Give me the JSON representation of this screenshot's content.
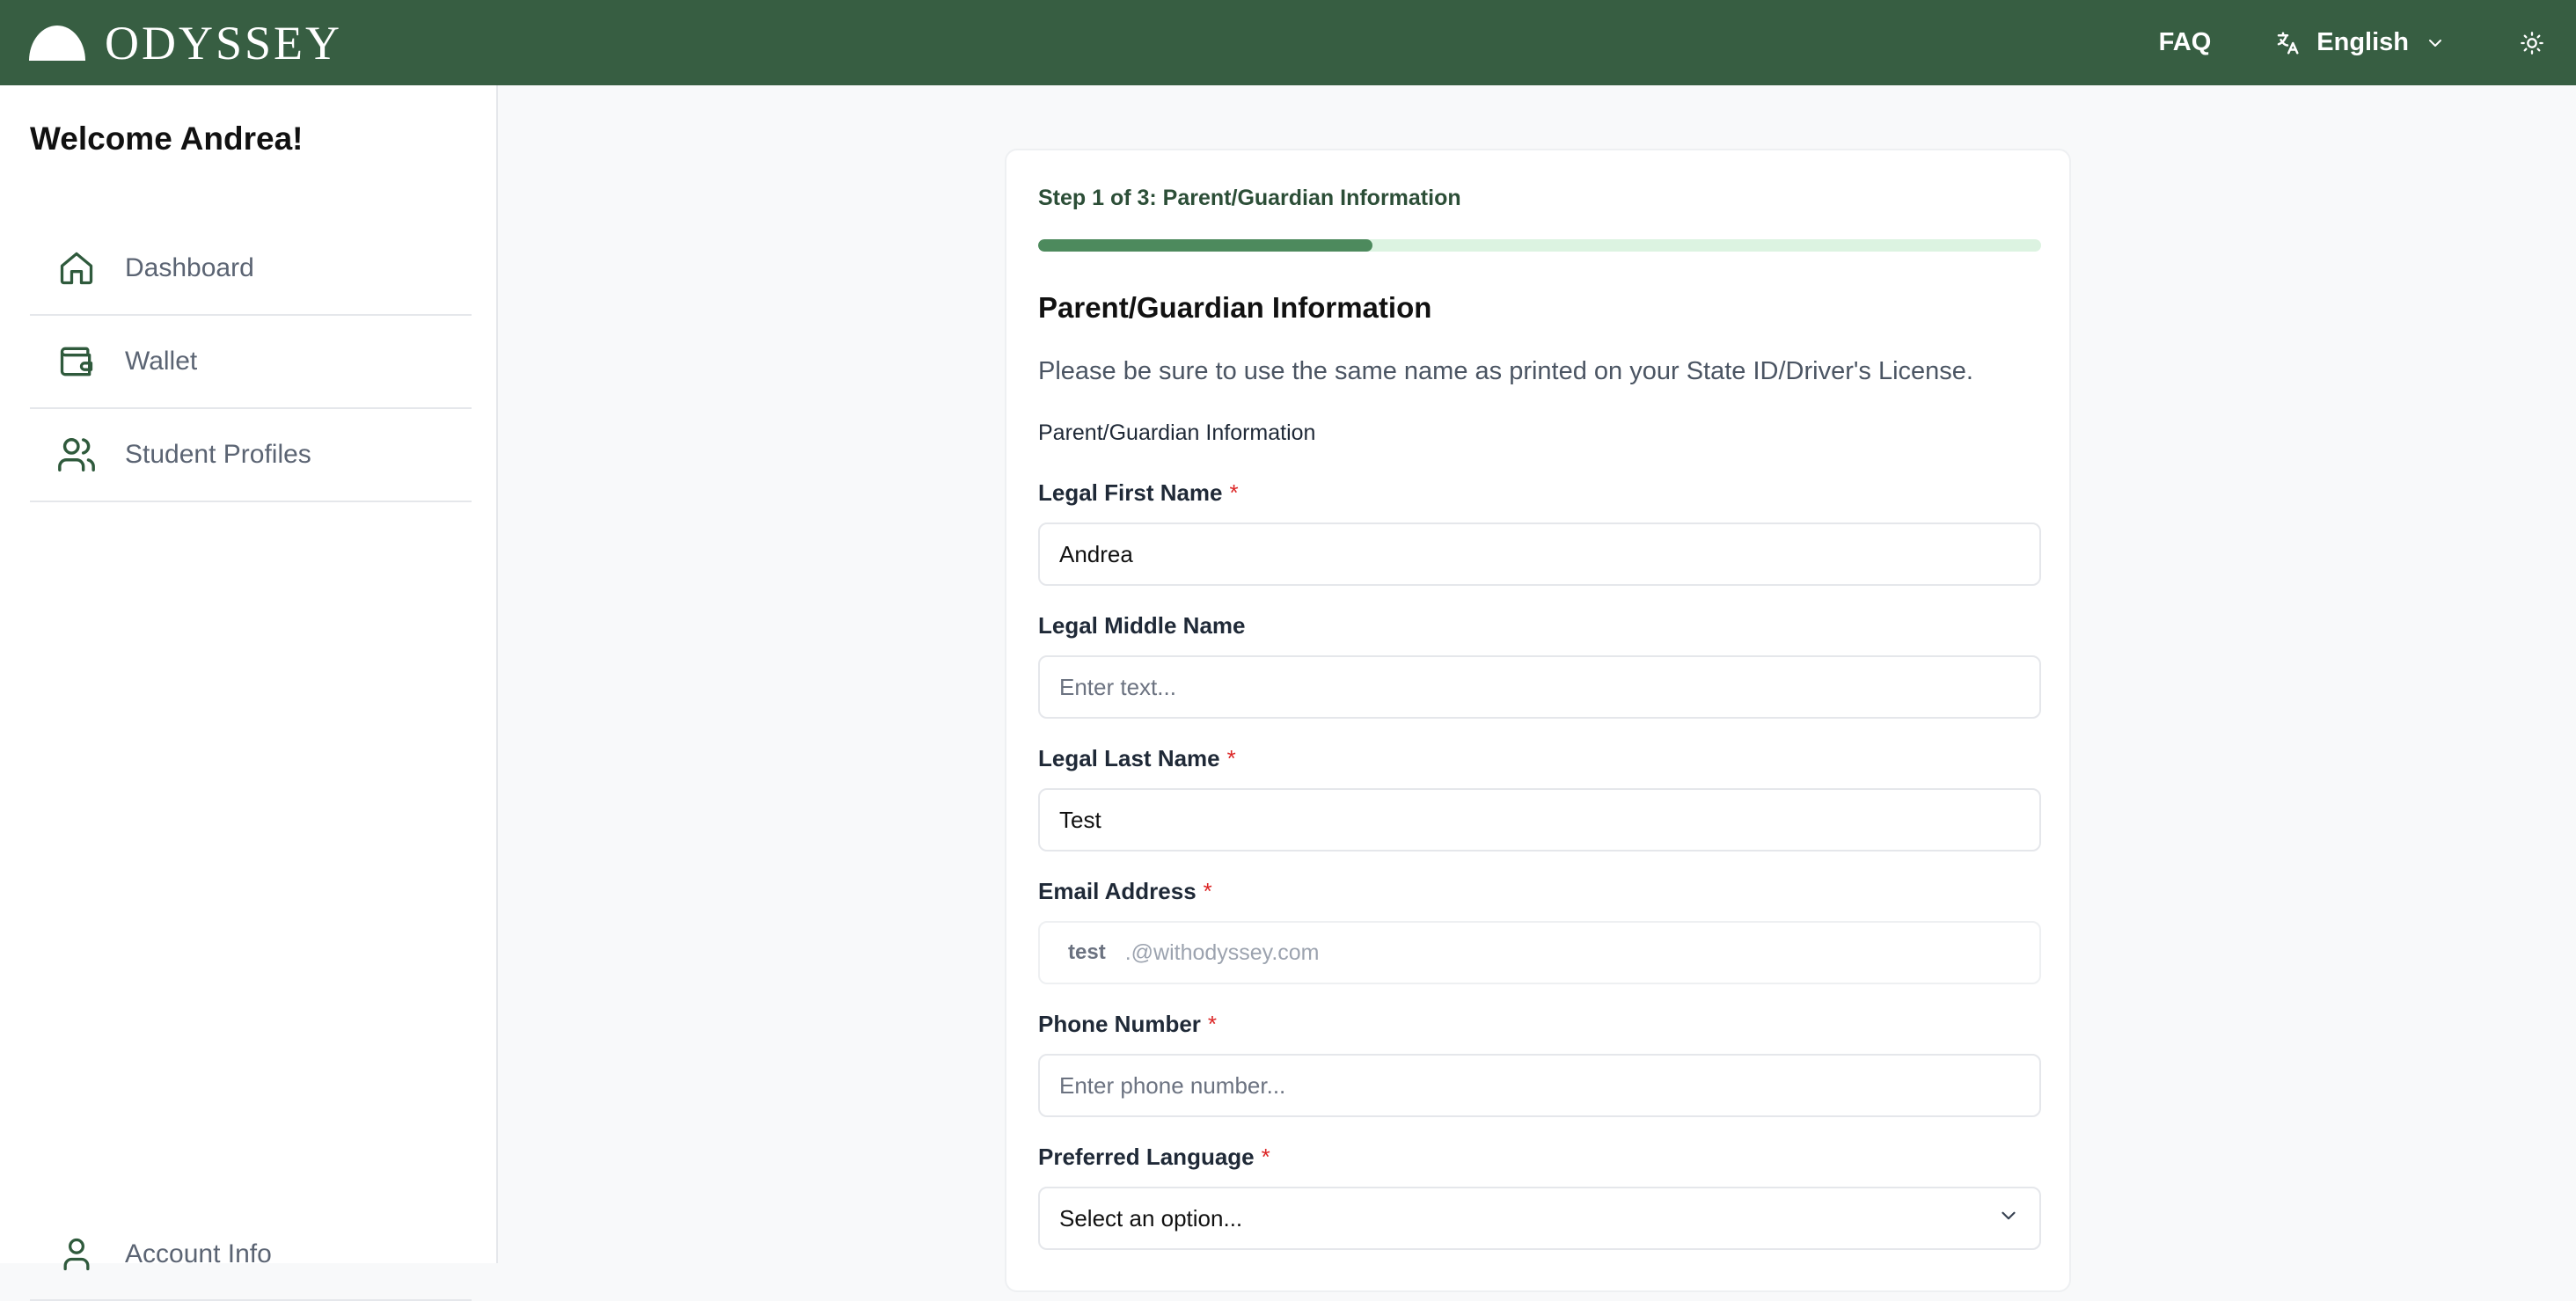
{
  "header": {
    "brand": "ODYSSEY",
    "faq": "FAQ",
    "language": "English"
  },
  "sidebar": {
    "welcome": "Welcome Andrea!",
    "items": [
      {
        "label": "Dashboard",
        "icon": "home-icon"
      },
      {
        "label": "Wallet",
        "icon": "wallet-icon"
      },
      {
        "label": "Student Profiles",
        "icon": "users-icon"
      }
    ],
    "bottom_item": {
      "label": "Account Info",
      "icon": "user-icon"
    }
  },
  "form": {
    "step": "Step 1 of 3: Parent/Guardian Information",
    "progress_fraction": 0.333,
    "title": "Parent/Guardian Information",
    "subtitle": "Please be sure to use the same name as printed on your State ID/Driver's License.",
    "section_label": "Parent/Guardian Information",
    "required_marker": "*",
    "first_name": {
      "label": "Legal First Name",
      "value": "Andrea",
      "placeholder": "Enter text..."
    },
    "middle_name": {
      "label": "Legal Middle Name",
      "value": "",
      "placeholder": "Enter text..."
    },
    "last_name": {
      "label": "Legal Last Name",
      "value": "Test",
      "placeholder": "Enter text..."
    },
    "email": {
      "label": "Email Address",
      "prefix": "test",
      "domain": ".@withodyssey.com"
    },
    "phone": {
      "label": "Phone Number",
      "value": "",
      "placeholder": "Enter phone number..."
    },
    "language": {
      "label": "Preferred Language",
      "selected": "Select an option..."
    }
  },
  "colors": {
    "header_bg": "#375e42",
    "progress_fill": "#4d8a5d",
    "progress_track": "#dcf3e1",
    "required": "#dc2626"
  }
}
